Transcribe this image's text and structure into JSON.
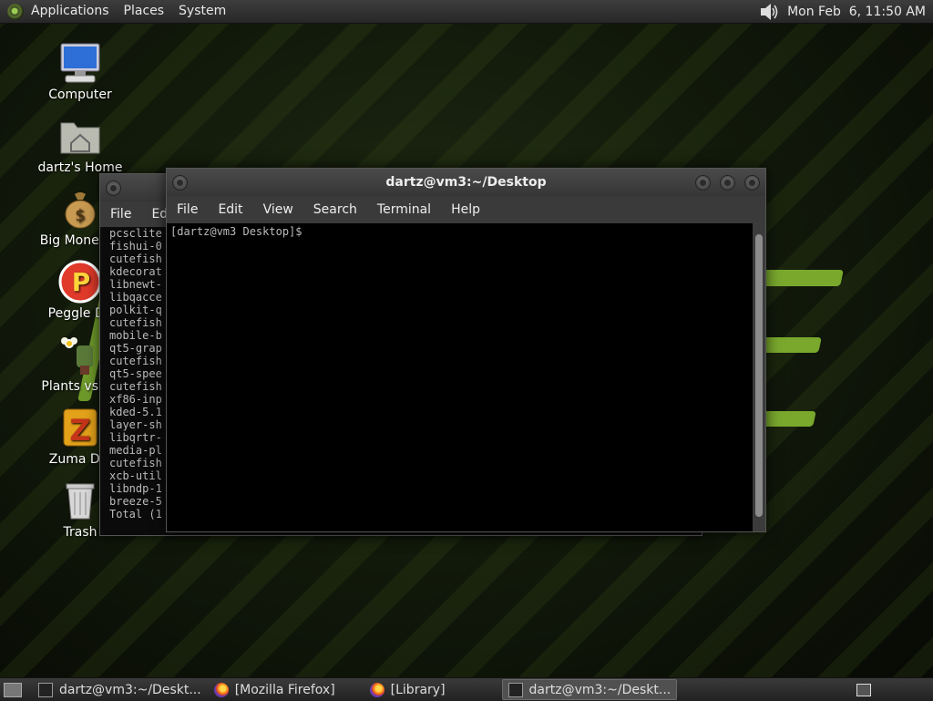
{
  "top_panel": {
    "menus": [
      "Applications",
      "Places",
      "System"
    ],
    "clock": "Mon Feb  6, 11:50 AM"
  },
  "desktop": {
    "icons": [
      {
        "label": "Computer"
      },
      {
        "label": "dartz's Home"
      },
      {
        "label": "Big Money D"
      },
      {
        "label": "Peggle De"
      },
      {
        "label": "Plants vs Zo"
      },
      {
        "label": "Zuma Del"
      },
      {
        "label": "Trash"
      }
    ]
  },
  "back_window": {
    "menu": [
      "File",
      "Edi"
    ],
    "lines": [
      "pcsclite",
      "fishui-0",
      "cutefish",
      "kdecorat",
      "libnewt-",
      "libqacce",
      "polkit-q",
      "cutefish",
      "mobile-b",
      "qt5-grap",
      "cutefish",
      "qt5-spee",
      "cutefish",
      "xf86-inp",
      "kded-5.1",
      "layer-sh",
      "libqrtr-",
      "media-pl",
      "cutefish",
      "xcb-util",
      "libndp-1",
      "breeze-5",
      "Total (1"
    ]
  },
  "terminal": {
    "title": "dartz@vm3:~/Desktop",
    "menu": [
      "File",
      "Edit",
      "View",
      "Search",
      "Terminal",
      "Help"
    ],
    "prompt": "[dartz@vm3 Desktop]$"
  },
  "taskbar": {
    "tasks": [
      {
        "label": "dartz@vm3:~/Deskt...",
        "icon": "terminal-icon",
        "active": false
      },
      {
        "label": "[Mozilla Firefox]",
        "icon": "firefox-icon",
        "active": false
      },
      {
        "label": "[Library]",
        "icon": "firefox-icon",
        "active": false
      },
      {
        "label": "dartz@vm3:~/Deskt...",
        "icon": "terminal-icon",
        "active": true
      }
    ]
  },
  "colors": {
    "accent_green": "#79a82d",
    "panel_bg": "#2e2e2e",
    "terminal_bg": "#000000"
  }
}
